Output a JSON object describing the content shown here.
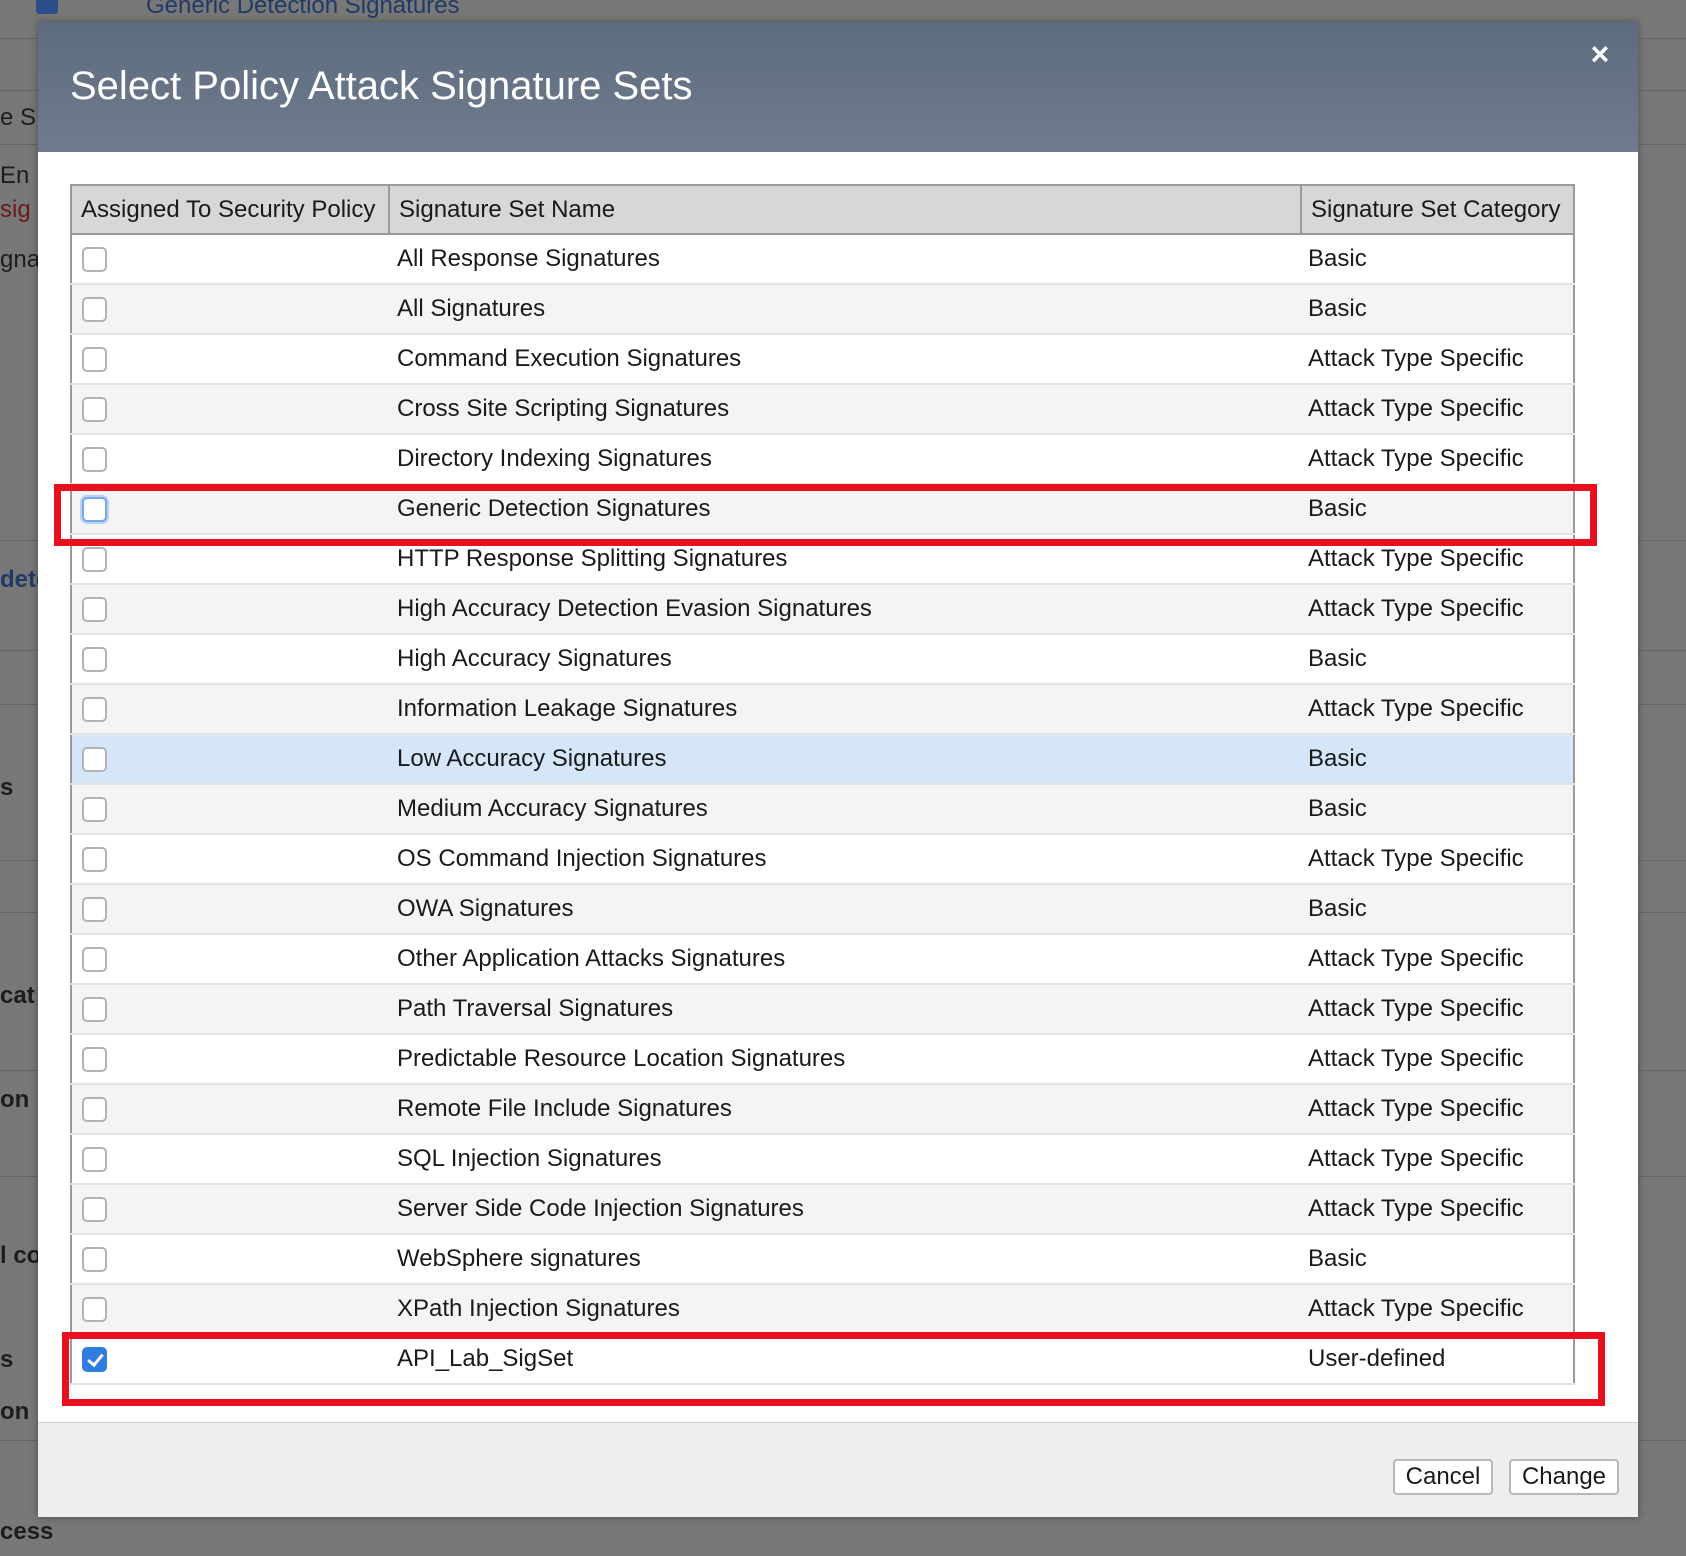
{
  "background": {
    "top_text": "Generic Detection Signatures",
    "fragments": [
      "e S",
      "En",
      "sig",
      "gna",
      "dete",
      "s",
      "cat",
      "on",
      "l co",
      "s",
      "on",
      "cess"
    ]
  },
  "modal": {
    "title": "Select Policy Attack Signature Sets",
    "close_label": "×"
  },
  "table": {
    "headers": [
      "Assigned To Security Policy",
      "Signature Set Name",
      "Signature Set Category"
    ],
    "rows": [
      {
        "name": "All Response Signatures",
        "category": "Basic",
        "checked": false
      },
      {
        "name": "All Signatures",
        "category": "Basic",
        "checked": false
      },
      {
        "name": "Command Execution Signatures",
        "category": "Attack Type Specific",
        "checked": false
      },
      {
        "name": "Cross Site Scripting Signatures",
        "category": "Attack Type Specific",
        "checked": false
      },
      {
        "name": "Directory Indexing Signatures",
        "category": "Attack Type Specific",
        "checked": false
      },
      {
        "name": "Generic Detection Signatures",
        "category": "Basic",
        "checked": false,
        "focused": true,
        "highlighted": true
      },
      {
        "name": "HTTP Response Splitting Signatures",
        "category": "Attack Type Specific",
        "checked": false
      },
      {
        "name": "High Accuracy Detection Evasion Signatures",
        "category": "Attack Type Specific",
        "checked": false
      },
      {
        "name": "High Accuracy Signatures",
        "category": "Basic",
        "checked": false
      },
      {
        "name": "Information Leakage Signatures",
        "category": "Attack Type Specific",
        "checked": false
      },
      {
        "name": "Low Accuracy Signatures",
        "category": "Basic",
        "checked": false,
        "hovered": true
      },
      {
        "name": "Medium Accuracy Signatures",
        "category": "Basic",
        "checked": false
      },
      {
        "name": "OS Command Injection Signatures",
        "category": "Attack Type Specific",
        "checked": false
      },
      {
        "name": "OWA Signatures",
        "category": "Basic",
        "checked": false
      },
      {
        "name": "Other Application Attacks Signatures",
        "category": "Attack Type Specific",
        "checked": false
      },
      {
        "name": "Path Traversal Signatures",
        "category": "Attack Type Specific",
        "checked": false
      },
      {
        "name": "Predictable Resource Location Signatures",
        "category": "Attack Type Specific",
        "checked": false
      },
      {
        "name": "Remote File Include Signatures",
        "category": "Attack Type Specific",
        "checked": false
      },
      {
        "name": "SQL Injection Signatures",
        "category": "Attack Type Specific",
        "checked": false
      },
      {
        "name": "Server Side Code Injection Signatures",
        "category": "Attack Type Specific",
        "checked": false
      },
      {
        "name": "WebSphere signatures",
        "category": "Basic",
        "checked": false
      },
      {
        "name": "XPath Injection Signatures",
        "category": "Attack Type Specific",
        "checked": false
      },
      {
        "name": "API_Lab_SigSet",
        "category": "User-defined",
        "checked": true,
        "highlighted": true
      }
    ]
  },
  "footer": {
    "cancel_label": "Cancel",
    "change_label": "Change"
  },
  "colors": {
    "header_bg": "#66748a",
    "highlight_red": "#e8101e",
    "hover_row": "#d5e6f8",
    "checkbox_checked": "#2f7de1"
  }
}
